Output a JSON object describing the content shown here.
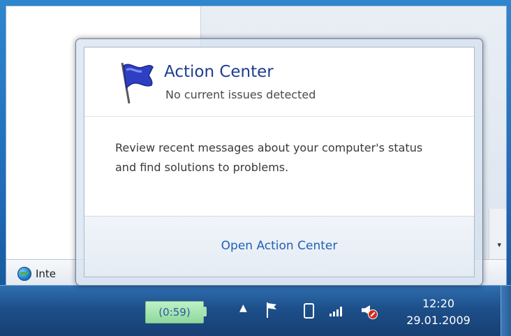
{
  "popup": {
    "title": "Action Center",
    "subtitle": "No current issues detected",
    "description": "Review recent messages about your computer's status and find solutions to problems.",
    "link_label": "Open Action Center"
  },
  "background_window": {
    "status_item_label": "Inte"
  },
  "taskbar": {
    "battery_time": "(0:59)",
    "clock_time": "12:20",
    "clock_date": "29.01.2009"
  },
  "icons": {
    "action_center": "flag-icon",
    "tray_chevron": "chevron-up-icon",
    "flag_tray": "flag-icon",
    "phone": "phone-icon",
    "signal": "signal-bars-icon",
    "volume": "speaker-muted-icon",
    "browser": "internet-explorer-icon"
  },
  "colors": {
    "title": "#1e3d92",
    "link": "#1f5fb8",
    "taskbar": "#1d4f8a",
    "battery": "#8fd89c",
    "mute": "#d42a1e"
  }
}
